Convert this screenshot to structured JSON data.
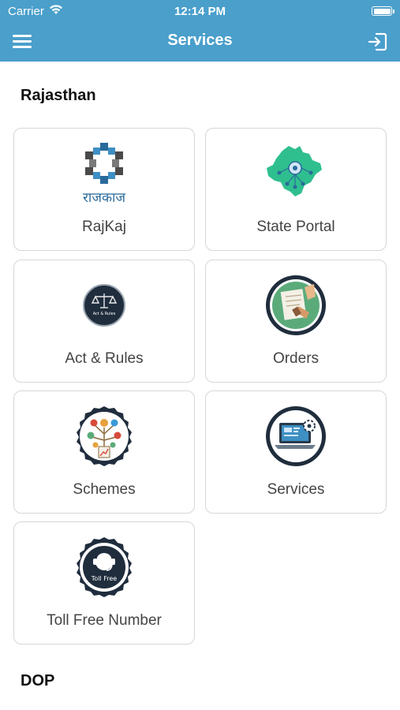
{
  "status_bar": {
    "carrier": "Carrier",
    "time": "12:14 PM"
  },
  "nav": {
    "title": "Services",
    "menu_icon": "hamburger-menu-icon",
    "logout_icon": "logout-icon"
  },
  "sections": [
    {
      "title": "Rajasthan",
      "items": [
        {
          "label": "RajKaj",
          "icon": "rajkaj-logo",
          "logo_text": "राजकाज"
        },
        {
          "label": "State Portal",
          "icon": "rajasthan-map-icon"
        },
        {
          "label": "Act & Rules",
          "icon": "scales-icon",
          "badge_text": "Act & Rules"
        },
        {
          "label": "Orders",
          "icon": "orders-icon"
        },
        {
          "label": "Schemes",
          "icon": "schemes-icon"
        },
        {
          "label": "Services",
          "icon": "services-icon"
        },
        {
          "label": "Toll Free Number",
          "icon": "toll-free-icon",
          "badge_text": "Toll Free"
        }
      ]
    },
    {
      "title": "DOP"
    }
  ],
  "colors": {
    "header": "#4a9fcb",
    "card_border": "#d6d6d6",
    "badge_dark": "#1f2d3d",
    "map_green": "#2fbf8f"
  }
}
